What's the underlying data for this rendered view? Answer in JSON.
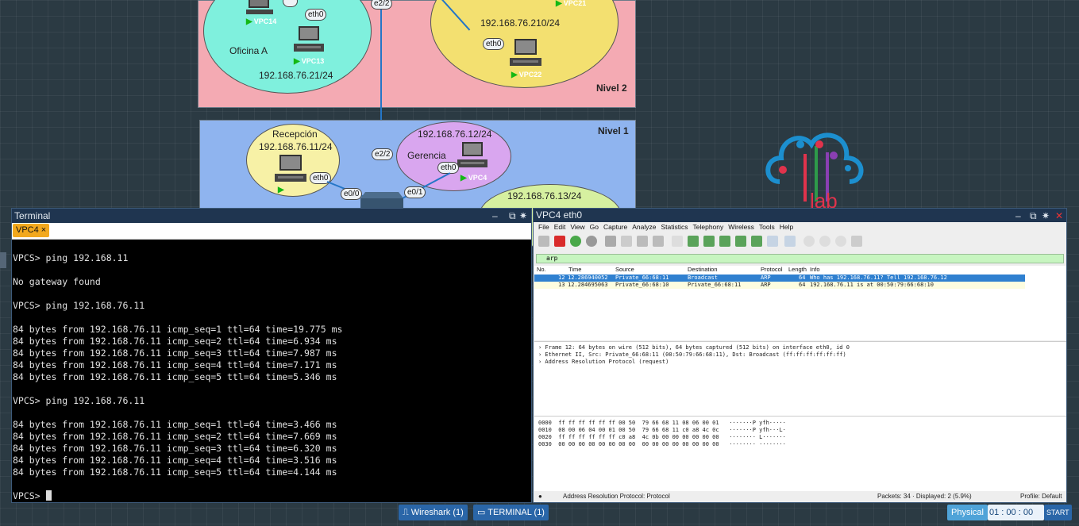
{
  "topology": {
    "nivel2": {
      "label": "Nivel 2",
      "oficina_a": {
        "name": "Oficina A",
        "subnet": "192.168.76.21/24"
      },
      "right_zone": {
        "subnet": "192.168.76.210/24"
      },
      "nodes": {
        "vpc14": "VPC14",
        "vpc13": "VPC13",
        "vpc21": "VPC21",
        "vpc22": "VPC22"
      },
      "interfaces": {
        "vpc13_eth": "eth0",
        "vpc22_eth": "eth0",
        "uplink": "e2/2"
      }
    },
    "nivel1": {
      "label": "Nivel 1",
      "recepcion": {
        "name": "Recepción",
        "subnet": "192.168.76.11/24"
      },
      "gerencia": {
        "name": "Gerencia",
        "subnet": "192.168.76.12/24"
      },
      "third": {
        "subnet": "192.168.76.13/24"
      },
      "nodes": {
        "vpc4": "VPC4"
      },
      "interfaces": {
        "uplink": "e2/2",
        "recepcion_eth": "eth0",
        "gerencia_eth": "eth0",
        "sw_e00": "e0/0",
        "sw_e01": "e0/1"
      }
    },
    "logo": {
      "text": "lab"
    }
  },
  "terminal": {
    "title": "Terminal",
    "tab_label": "VPC4 ×",
    "lines": [
      "",
      "VPCS> ping 192.168.11",
      "",
      "No gateway found",
      "",
      "VPCS> ping 192.168.76.11",
      "",
      "84 bytes from 192.168.76.11 icmp_seq=1 ttl=64 time=19.775 ms",
      "84 bytes from 192.168.76.11 icmp_seq=2 ttl=64 time=6.934 ms",
      "84 bytes from 192.168.76.11 icmp_seq=3 ttl=64 time=7.987 ms",
      "84 bytes from 192.168.76.11 icmp_seq=4 ttl=64 time=7.171 ms",
      "84 bytes from 192.168.76.11 icmp_seq=5 ttl=64 time=5.346 ms",
      "",
      "VPCS> ping 192.168.76.11",
      "",
      "84 bytes from 192.168.76.11 icmp_seq=1 ttl=64 time=3.466 ms",
      "84 bytes from 192.168.76.11 icmp_seq=2 ttl=64 time=7.669 ms",
      "84 bytes from 192.168.76.11 icmp_seq=3 ttl=64 time=6.320 ms",
      "84 bytes from 192.168.76.11 icmp_seq=4 ttl=64 time=3.516 ms",
      "84 bytes from 192.168.76.11 icmp_seq=5 ttl=64 time=4.144 ms",
      "",
      "VPCS> "
    ]
  },
  "wireshark": {
    "title": "VPC4 eth0",
    "menu": [
      "File",
      "Edit",
      "View",
      "Go",
      "Capture",
      "Analyze",
      "Statistics",
      "Telephony",
      "Wireless",
      "Tools",
      "Help"
    ],
    "filter": "arp",
    "columns": [
      "No.",
      "Time",
      "Source",
      "Destination",
      "Protocol",
      "Length",
      "Info"
    ],
    "packets": [
      {
        "no": "12",
        "time": "12.286940052",
        "src": "Private_66:68:11",
        "dst": "Broadcast",
        "proto": "ARP",
        "len": "64",
        "info": "Who has 192.168.76.11? Tell 192.168.76.12"
      },
      {
        "no": "13",
        "time": "12.284695063",
        "src": "Private_66:68:10",
        "dst": "Private_66:68:11",
        "proto": "ARP",
        "len": "64",
        "info": "192.168.76.11 is at 00:50:79:66:68:10"
      }
    ],
    "details": [
      "› Frame 12: 64 bytes on wire (512 bits), 64 bytes captured (512 bits) on interface eth0, id 0",
      "› Ethernet II, Src: Private_66:68:11 (00:50:79:66:68:11), Dst: Broadcast (ff:ff:ff:ff:ff:ff)",
      "› Address Resolution Protocol (request)"
    ],
    "hex": [
      "0000  ff ff ff ff ff ff 00 50  79 66 68 11 08 06 00 01   ·······P yfh·····",
      "0010  08 00 06 04 00 01 00 50  79 66 68 11 c0 a8 4c 0c   ·······P yfh···L·",
      "0020  ff ff ff ff ff ff c0 a8  4c 0b 00 00 00 00 00 00   ········ L·······",
      "0030  00 00 00 00 00 00 00 00  00 00 00 00 00 00 00 00   ········ ········"
    ],
    "status_left": "Address Resolution Protocol: Protocol",
    "status_mid": "Packets: 34 · Displayed: 2 (5.9%)",
    "status_right": "Profile: Default"
  },
  "taskbar": {
    "wireshark": "Wireshark (1)",
    "terminal": "TERMINAL (1)",
    "mode": "Physical",
    "time_h": "01",
    "time_m": "00",
    "time_s": "00",
    "start": "START"
  },
  "colors": {
    "nivel2_bg": "#f4aab3",
    "nivel1_bg": "#8fb4ef",
    "selected_row": "#2f80d0",
    "filter_bg": "#c7f5c0",
    "terminal_tab": "#f2a81d"
  }
}
